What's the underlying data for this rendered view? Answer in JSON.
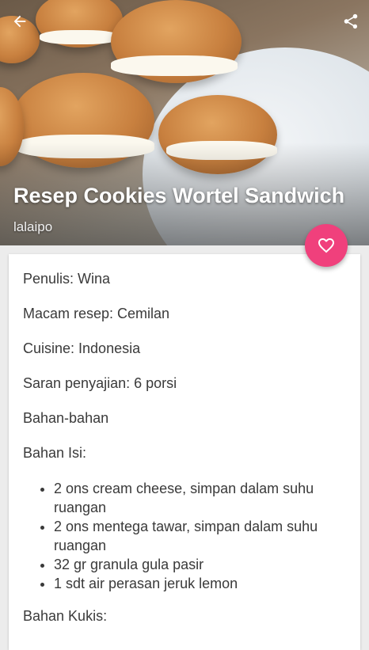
{
  "header": {
    "title": "Resep Cookies Wortel Sandwich",
    "author": "lalaipo"
  },
  "icons": {
    "back": "arrow-back-icon",
    "share": "share-icon",
    "favorite": "heart-outline-icon"
  },
  "colors": {
    "fab": "#f0407c",
    "card": "#ffffff",
    "background": "#ececec"
  },
  "details": {
    "penulis": "Penulis: Wina",
    "macam": "Macam resep: Cemilan",
    "cuisine": "Cuisine: Indonesia",
    "saran": "Saran penyajian: 6 porsi",
    "bahan": "Bahan-bahan",
    "bahan_isi": "Bahan Isi:",
    "bahan_kukis": "Bahan Kukis:"
  },
  "ingredients_isi": [
    "2 ons cream cheese, simpan dalam suhu ruangan",
    "2 ons mentega tawar, simpan dalam suhu ruangan",
    "32 gr granula gula pasir",
    "1 sdt air perasan jeruk lemon"
  ]
}
